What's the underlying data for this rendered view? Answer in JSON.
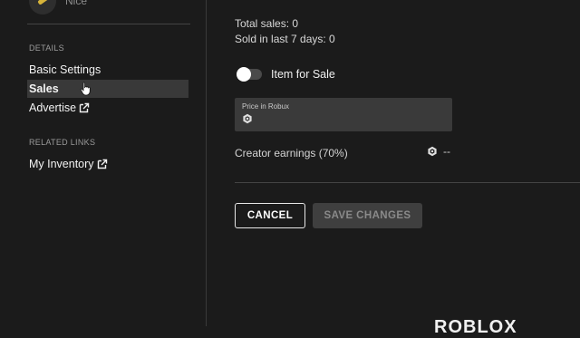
{
  "item": {
    "name": "Nice"
  },
  "sidebar": {
    "details_heading": "DETAILS",
    "items": [
      {
        "label": "Basic Settings"
      },
      {
        "label": "Sales"
      },
      {
        "label": "Advertise"
      }
    ],
    "related_heading": "RELATED LINKS",
    "related_items": [
      {
        "label": "My Inventory"
      }
    ]
  },
  "sales": {
    "total_sales": "Total sales: 0",
    "sold_last_7_days": "Sold in last 7 days: 0",
    "item_for_sale_label": "Item for Sale",
    "item_for_sale_enabled": false,
    "price_label": "Price in Robux",
    "creator_earnings_label": "Creator earnings (70%)",
    "creator_earnings_value": "--"
  },
  "buttons": {
    "cancel": "CANCEL",
    "save": "SAVE CHANGES"
  },
  "footer": {
    "logo": "ROBLOX"
  },
  "colors": {
    "background": "#1b1b1b",
    "active_nav": "#393939",
    "input_bg": "#3a3a3a",
    "disabled_button": "#3f3f3f"
  }
}
